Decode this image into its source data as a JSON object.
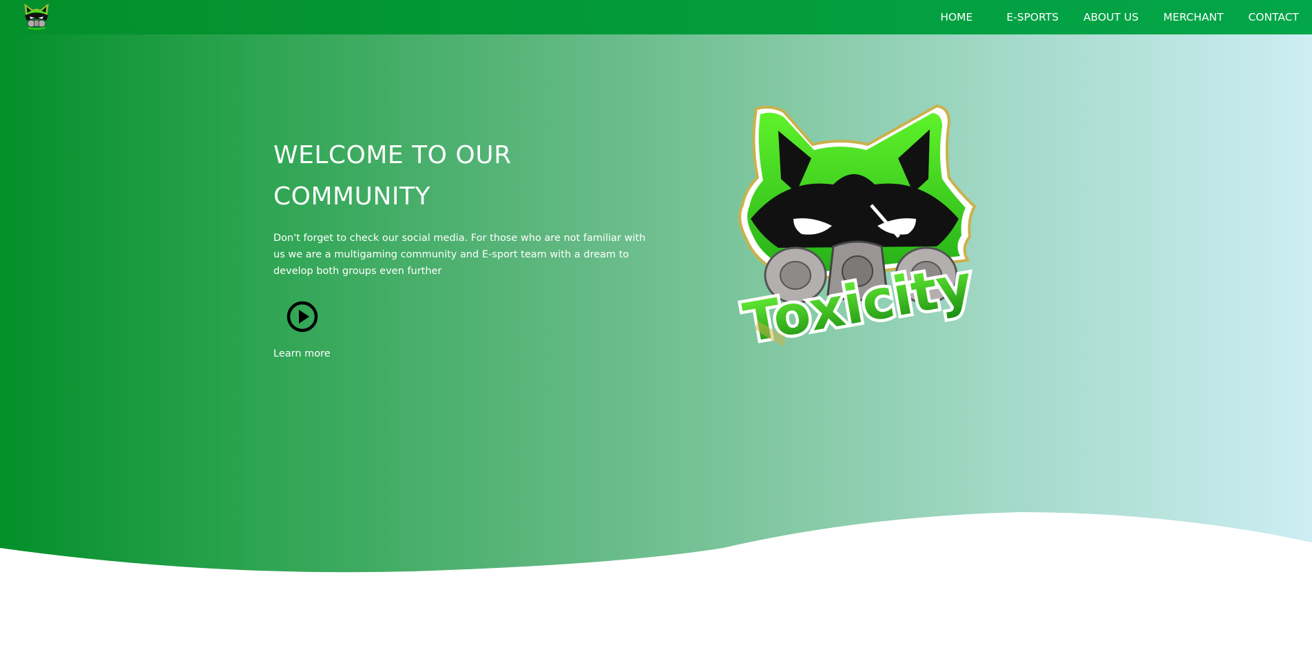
{
  "nav": {
    "logo_icon": "toxicity-raccoon-logo-icon",
    "items": [
      {
        "label": "HOME"
      },
      {
        "label": "E-SPORTS"
      },
      {
        "label": "ABOUT US"
      },
      {
        "label": "MERCHANT"
      },
      {
        "label": "CONTACT"
      }
    ]
  },
  "hero": {
    "title_line1": "WELCOME TO OUR",
    "title_line2": "COMMUNITY",
    "description": "Don't forget to check our social media. For those who are not familiar with us we are a multigaming community and E-sport team with a dream to develop both groups even further",
    "play_icon": "play-icon",
    "learn_more": "Learn more",
    "logo_text": "Toxicity"
  },
  "colors": {
    "brand_green": "#038f2a",
    "nav_end": "#03a64a",
    "gradient_end": "#cdeef3",
    "text": "#ffffff"
  }
}
